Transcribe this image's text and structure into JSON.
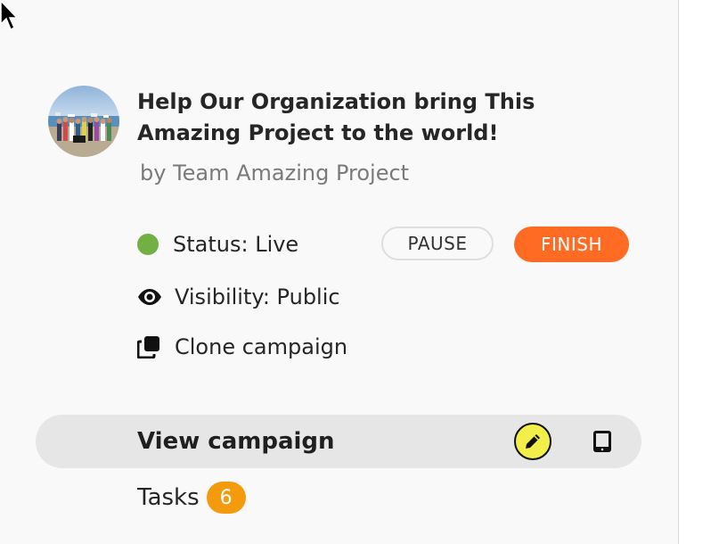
{
  "campaign": {
    "title": "Help Our Organization bring This Amazing Project to the world!",
    "byline": "by Team Amazing Project"
  },
  "status": {
    "label": "Status: Live",
    "color": "#72b043",
    "pause_label": "PAUSE",
    "finish_label": "FINISH",
    "finish_color": "#ff6b23"
  },
  "visibility": {
    "label": "Visibility: Public",
    "icon": "eye-icon"
  },
  "clone": {
    "label": "Clone campaign",
    "icon": "clone-icon"
  },
  "view": {
    "label": "View campaign",
    "edit_icon": "pencil-icon",
    "device_icon": "tablet-icon",
    "edit_color": "#f2ee4a"
  },
  "tasks": {
    "label": "Tasks",
    "count": "6",
    "badge_color": "#f49a0d"
  }
}
